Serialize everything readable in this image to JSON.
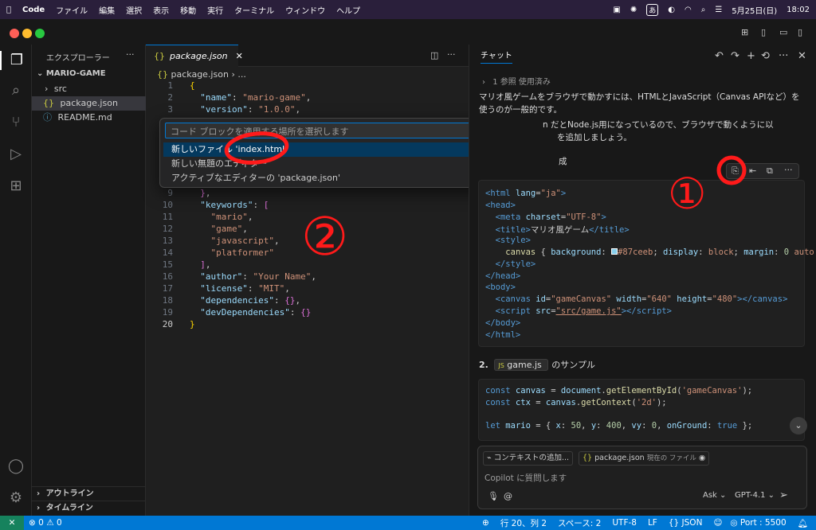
{
  "menubar": {
    "app": "Code",
    "items": [
      "ファイル",
      "編集",
      "選択",
      "表示",
      "移動",
      "実行",
      "ターミナル",
      "ウィンドウ",
      "ヘルプ"
    ],
    "date": "5月25日(日)",
    "time": "18:02",
    "input_method": "あ"
  },
  "sidebar": {
    "title": "エクスプローラー",
    "folder": "MARIO-GAME",
    "items": [
      {
        "label": "src",
        "icon": "chevron-right-icon"
      },
      {
        "label": "package.json",
        "icon": "json-icon"
      },
      {
        "label": "README.md",
        "icon": "info-icon"
      }
    ],
    "outline": "アウトライン",
    "timeline": "タイムライン"
  },
  "editor": {
    "tab_label": "package.json",
    "breadcrumb_file": "package.json",
    "breadcrumb_rest": "...",
    "lines": [
      {
        "n": "1",
        "html": "<span class=\"y\">{</span>"
      },
      {
        "n": "2",
        "html": "  <span class=\"k\">\"name\"</span>: <span class=\"s\">\"mario-game\"</span>,"
      },
      {
        "n": "3",
        "html": "  <span class=\"k\">\"version\"</span>: <span class=\"s\">\"1.0.0\"</span>,"
      },
      {
        "n": "9",
        "html": "  <span class=\"b\">}</span>,"
      },
      {
        "n": "10",
        "html": "  <span class=\"k\">\"keywords\"</span>: <span class=\"b\">[</span>"
      },
      {
        "n": "11",
        "html": "    <span class=\"s\">\"mario\"</span>,"
      },
      {
        "n": "12",
        "html": "    <span class=\"s\">\"game\"</span>,"
      },
      {
        "n": "13",
        "html": "    <span class=\"s\">\"javascript\"</span>,"
      },
      {
        "n": "14",
        "html": "    <span class=\"s\">\"platformer\"</span>"
      },
      {
        "n": "15",
        "html": "  <span class=\"b\">]</span>,"
      },
      {
        "n": "16",
        "html": "  <span class=\"k\">\"author\"</span>: <span class=\"s\">\"Your Name\"</span>,"
      },
      {
        "n": "17",
        "html": "  <span class=\"k\">\"license\"</span>: <span class=\"s\">\"MIT\"</span>,"
      },
      {
        "n": "18",
        "html": "  <span class=\"k\">\"dependencies\"</span>: <span class=\"b\">{}</span>,"
      },
      {
        "n": "19",
        "html": "  <span class=\"k\">\"devDependencies\"</span>: <span class=\"b\">{}</span>"
      },
      {
        "n": "20",
        "html": "<span class=\"y\">}</span>"
      }
    ]
  },
  "quickpick": {
    "placeholder": "コード ブロックを適用する場所を選択します",
    "items": [
      "新しいファイル 'index.html'",
      "新しい無題のエディター",
      "アクティブなエディターの 'package.json'"
    ]
  },
  "chat": {
    "tab_label": "チャット",
    "references": "1 参照 使用済み",
    "para1": "マリオ風ゲームをブラウザで動かすには、HTMLとJavaScript（Canvas APIなど）を使うのが一般的です。",
    "para2_a": "n だとNode.js用になっているので、ブラウザで動くように以",
    "para2_b": "を追加しましょう。",
    "section1_tail": "成",
    "html_code": [
      "<span class=\"t\">&lt;html</span> <span class=\"a\">lang</span>=<span class=\"v\">\"ja\"</span><span class=\"t\">&gt;</span>",
      "<span class=\"t\">&lt;head&gt;</span>",
      "  <span class=\"t\">&lt;meta</span> <span class=\"a\">charset</span>=<span class=\"v\">\"UTF-8\"</span><span class=\"t\">&gt;</span>",
      "  <span class=\"t\">&lt;title&gt;</span>マリオ風ゲーム<span class=\"t\">&lt;/title&gt;</span>",
      "  <span class=\"t\">&lt;style&gt;</span>",
      "    <span class=\"f\">canvas</span> { <span class=\"a\">background</span>: <span style=\"display:inline-block;width:8px;height:8px;background:#87ceeb;border:1px solid #fff\"></span><span class=\"v\">#87ceeb</span>; <span class=\"a\">display</span>: <span class=\"v\">block</span>; <span class=\"a\">margin</span>: <span class=\"n\">0</span> <span class=\"v\">auto</span>",
      "  <span class=\"t\">&lt;/style&gt;</span>",
      "<span class=\"t\">&lt;/head&gt;</span>",
      "<span class=\"t\">&lt;body&gt;</span>",
      "  <span class=\"t\">&lt;canvas</span> <span class=\"a\">id</span>=<span class=\"v\">\"gameCanvas\"</span> <span class=\"a\">width</span>=<span class=\"v\">\"640\"</span> <span class=\"a\">height</span>=<span class=\"v\">\"480\"</span><span class=\"t\">&gt;&lt;/canvas&gt;</span>",
      "  <span class=\"t\">&lt;script</span> <span class=\"a\">src</span>=<span class=\"v\" style=\"text-decoration:underline\">\"src/game.js\"</span><span class=\"t\">&gt;&lt;/script&gt;</span>",
      "<span class=\"t\">&lt;/body&gt;</span>",
      "<span class=\"t\">&lt;/html&gt;</span>"
    ],
    "section2_num": "2.",
    "section2_file": "game.js",
    "section2_tail": "のサンプル",
    "js_code": [
      "<span class=\"kw\">const</span> <span class=\"a\">canvas</span> = <span class=\"a\">document</span>.<span class=\"f\">getElementById</span>(<span class=\"v\">'gameCanvas'</span>);",
      "<span class=\"kw\">const</span> <span class=\"a\">ctx</span> = <span class=\"a\">canvas</span>.<span class=\"f\">getContext</span>(<span class=\"v\">'2d'</span>);",
      "",
      "<span class=\"kw\">let</span> <span class=\"a\">mario</span> = { <span class=\"a\">x</span>: <span class=\"n\">50</span>, <span class=\"a\">y</span>: <span class=\"n\">400</span>, <span class=\"a\">vy</span>: <span class=\"n\">0</span>, <span class=\"a\">onGround</span>: <span class=\"kw\">true</span> };"
    ],
    "context_button": "コンテキストの追加...",
    "context_file": "package.json",
    "context_file_note": "現在の ファイル",
    "input_placeholder": "Copilot に質問します",
    "mode": "Ask",
    "model": "GPT-4.1"
  },
  "statusbar": {
    "problems": "0",
    "warnings": "0",
    "position": "行 20、列 2",
    "spaces": "スペース: 2",
    "encoding": "UTF-8",
    "eol": "LF",
    "language": "{} JSON",
    "port": "Port : 5500"
  },
  "annotations": {
    "label1": "①",
    "label2": "②",
    "color": "#ff1a1a"
  },
  "colors": {
    "accent": "#0078d4",
    "selection": "#04395e"
  }
}
